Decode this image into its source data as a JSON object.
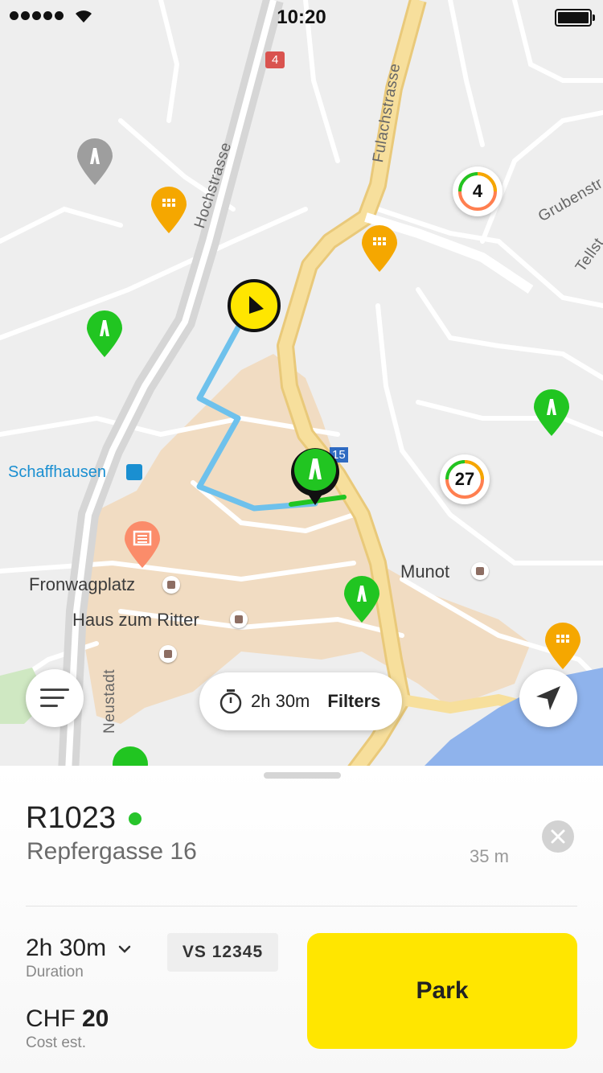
{
  "status_bar": {
    "time": "10:20"
  },
  "map": {
    "street_labels": {
      "hochstrasse": "Hochstrasse",
      "fulachstrasse": "Fulachstrasse",
      "grubenstrasse": "Grubenstr",
      "tellstrasse": "Tellst",
      "neustadt": "Neustadt"
    },
    "places": {
      "schaffhausen": "Schaffhausen",
      "fronwagplatz": "Fronwagplatz",
      "haus_zum_ritter": "Haus zum Ritter",
      "munot": "Munot"
    },
    "road_badge": "4",
    "route_badge": "15",
    "clusters": [
      {
        "count": "4"
      },
      {
        "count": "27"
      }
    ],
    "colors": {
      "parking_green": "#21c521",
      "garage_orange": "#f5a700",
      "user_yellow": "#ffe600",
      "route_blue": "#6ec1ec",
      "old_town": "#f1dcc2",
      "main_road": "#f7df9c"
    }
  },
  "controls": {
    "filter_duration": "2h 30m",
    "filter_label": "Filters"
  },
  "sheet": {
    "zone_id": "R1023",
    "address": "Repfergasse 16",
    "distance": "35 m",
    "duration_value": "2h 30m",
    "duration_label": "Duration",
    "plate": "VS 12345",
    "cost_currency": "CHF",
    "cost_amount": "20",
    "cost_label": "Cost est.",
    "park_button": "Park"
  }
}
